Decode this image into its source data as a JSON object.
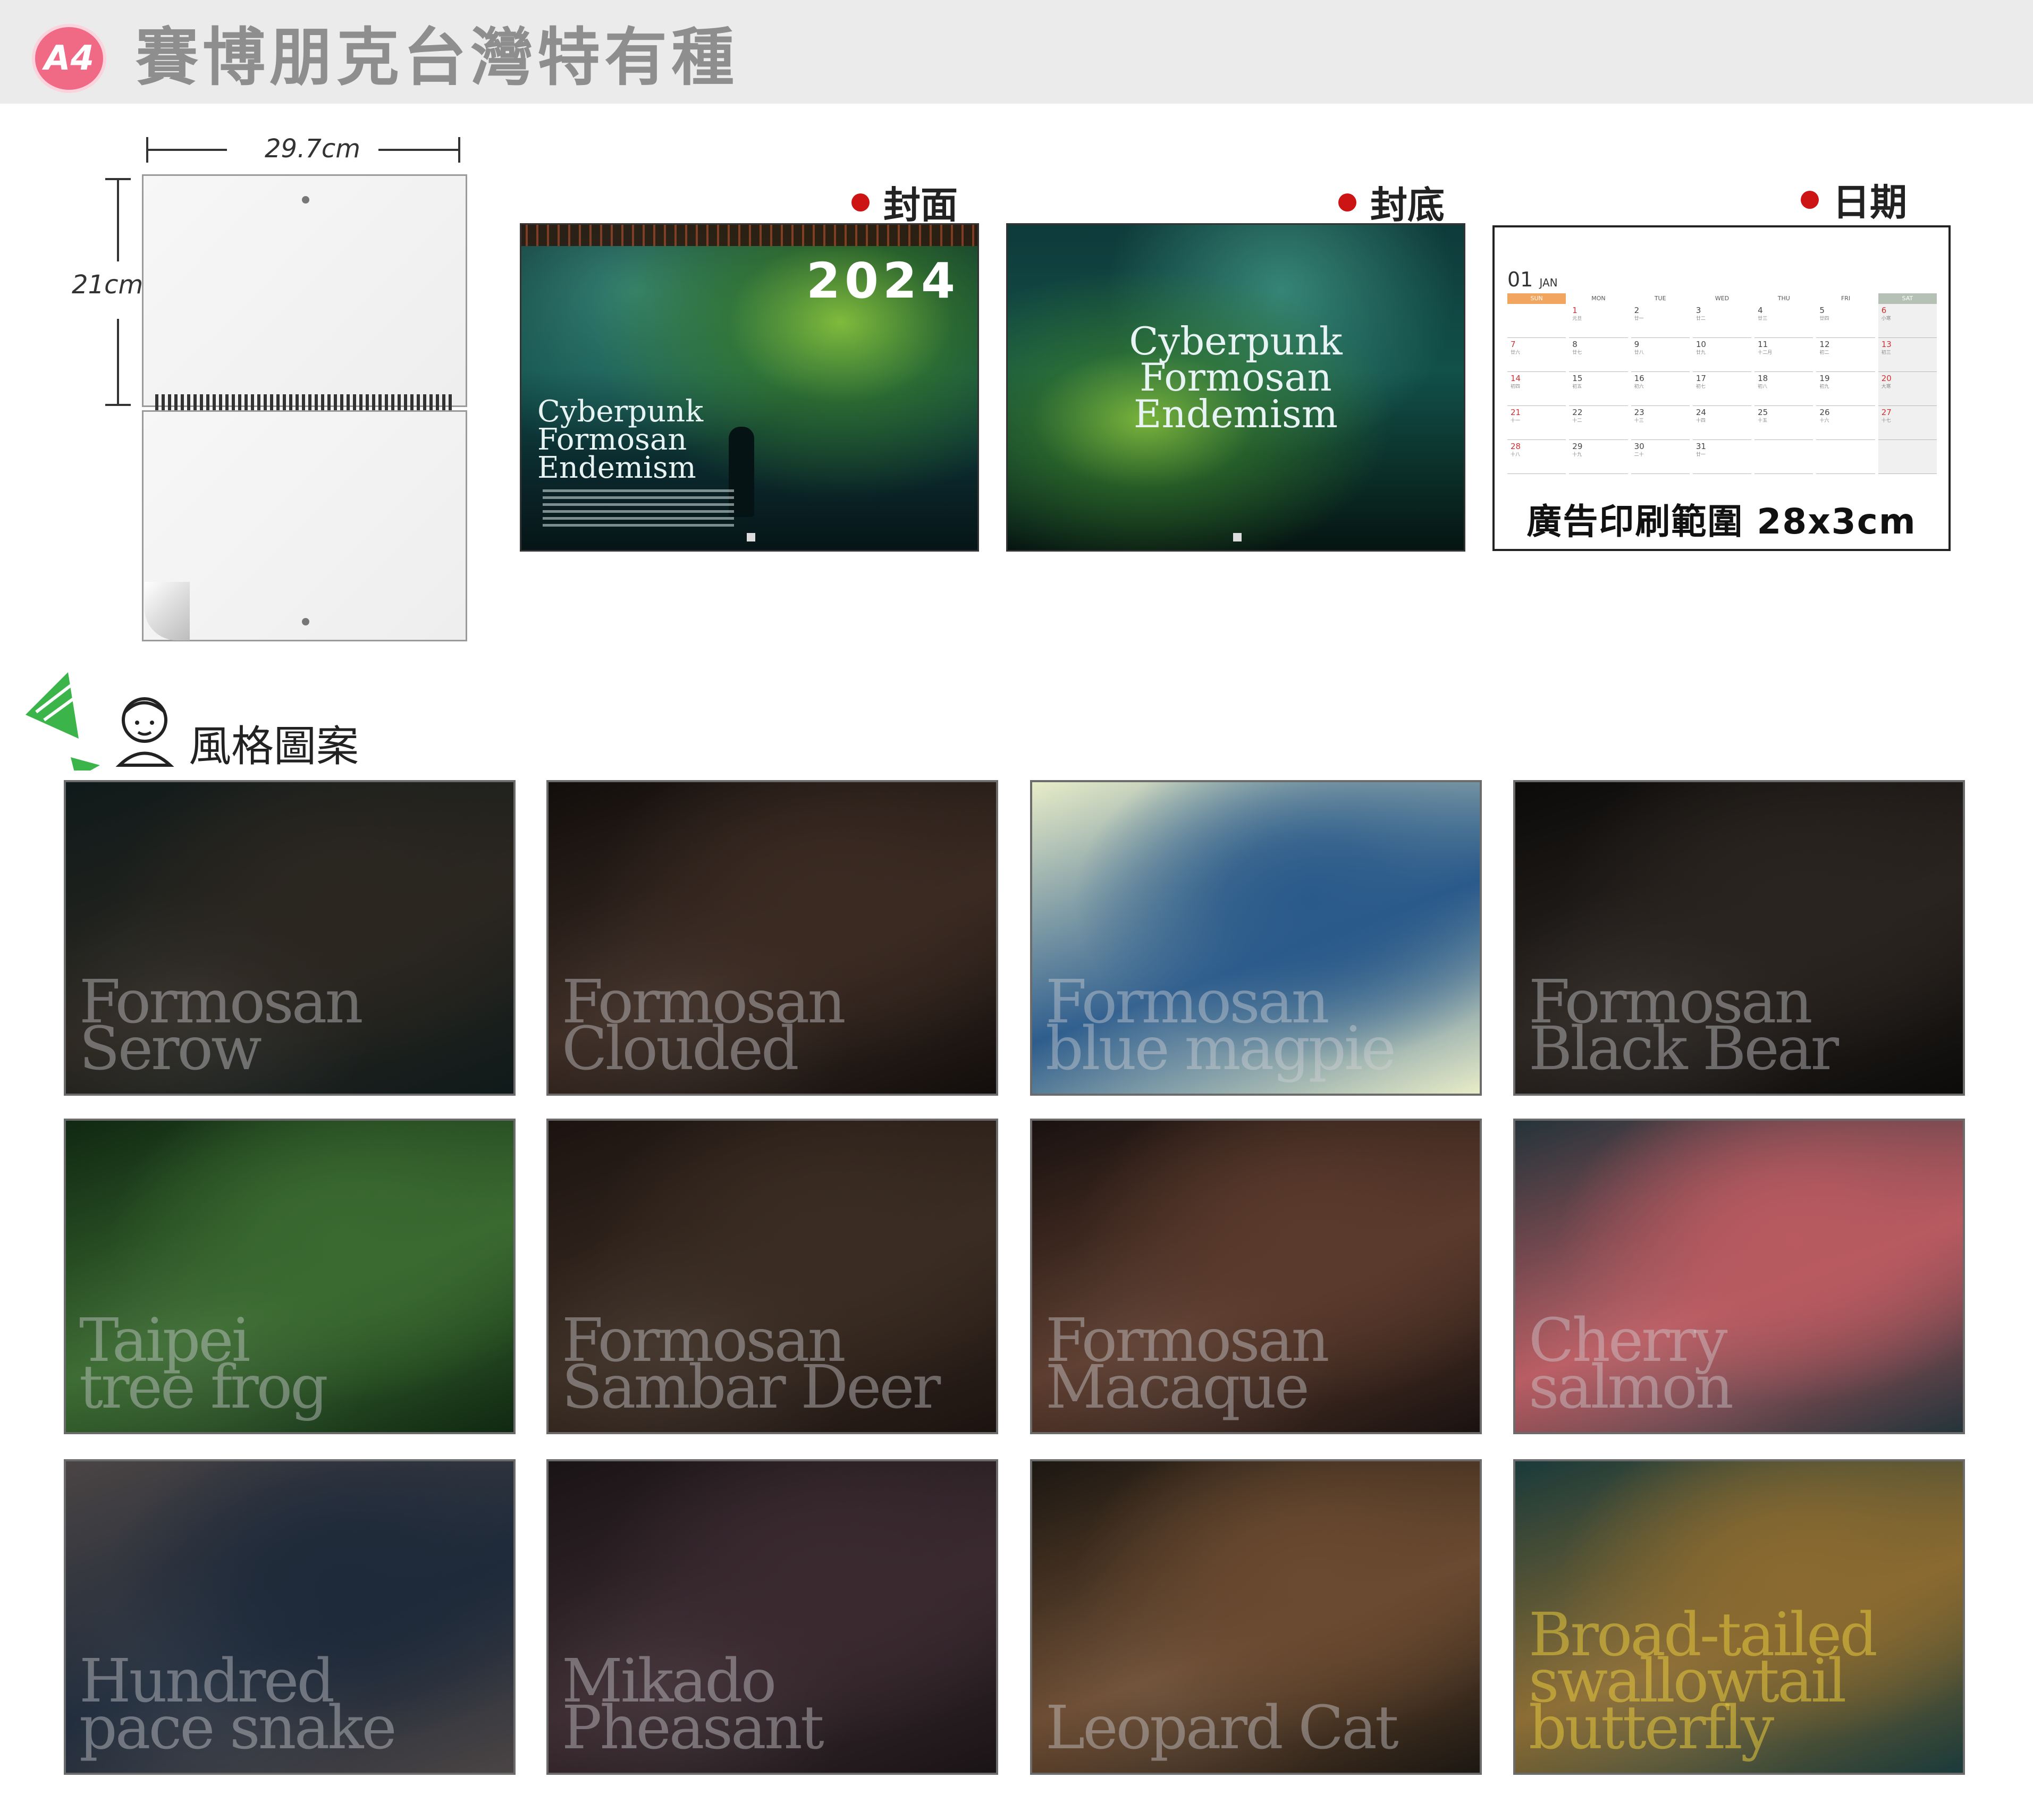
{
  "header": {
    "badge": "A4",
    "title": "賽博朋克台灣特有種"
  },
  "size": {
    "width_label": "29.7cm",
    "height_label": "21cm"
  },
  "previews": {
    "cover": {
      "label": "封面",
      "year": "2024",
      "title_lines": [
        "Cyberpunk",
        "Formosan",
        "Endemism"
      ]
    },
    "back": {
      "label": "封底",
      "title_lines": [
        "Cyberpunk",
        "Formosan",
        "Endemism"
      ]
    },
    "date": {
      "label": "日期",
      "month_num": "01",
      "month_name": "JAN",
      "weekdays": [
        "SUN",
        "MON",
        "TUE",
        "WED",
        "THU",
        "FRI",
        "SAT"
      ],
      "ad_range": "廣告印刷範圍 28x3cm"
    }
  },
  "section": {
    "title": "風格圖案"
  },
  "tiles": [
    {
      "label": [
        "Formosan",
        "Serow"
      ],
      "colors": [
        "#2b2620",
        "#0f1a1a"
      ]
    },
    {
      "label": [
        "Formosan",
        "Clouded"
      ],
      "colors": [
        "#3a2a22",
        "#120e0c"
      ]
    },
    {
      "label": [
        "Formosan",
        "blue magpie"
      ],
      "colors": [
        "#2a5a8a",
        "#e8ecc8"
      ]
    },
    {
      "label": [
        "Formosan",
        "Black Bear"
      ],
      "colors": [
        "#2a2420",
        "#0c0b0a"
      ]
    },
    {
      "label": [
        "Taipei",
        "tree frog"
      ],
      "colors": [
        "#3a6a30",
        "#102812"
      ]
    },
    {
      "label": [
        "Formosan",
        "Sambar Deer"
      ],
      "colors": [
        "#3a2c22",
        "#1c1310"
      ]
    },
    {
      "label": [
        "Formosan",
        "Macaque"
      ],
      "colors": [
        "#5a3a2c",
        "#1a1210"
      ]
    },
    {
      "label": [
        "Cherry",
        "salmon"
      ],
      "colors": [
        "#b85a60",
        "#24343a"
      ]
    },
    {
      "label": [
        "Hundred",
        "pace snake"
      ],
      "colors": [
        "#1e2a3a",
        "#4a4444"
      ]
    },
    {
      "label": [
        "Mikado",
        "Pheasant"
      ],
      "colors": [
        "#3a2a30",
        "#1a1416"
      ]
    },
    {
      "label": [
        "Leopard Cat",
        ""
      ],
      "colors": [
        "#6a4a30",
        "#1c1712"
      ]
    },
    {
      "label": [
        "Broad-tailed",
        "swallowtail",
        "butterfly"
      ],
      "colors": [
        "#8a6a30",
        "#1a3a3a"
      ]
    }
  ]
}
